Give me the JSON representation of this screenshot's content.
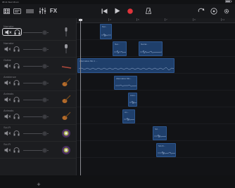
{
  "status": {
    "time": "08:41",
    "date": "Wed 18 oct.",
    "battery": ""
  },
  "toolbar": {
    "icons": [
      "my-songs-icon",
      "browser-icon",
      "tracks-view-icon",
      "mixer-icon",
      "fx-icon",
      "go-to-start-icon",
      "play-icon",
      "record-icon",
      "metronome-icon",
      "settings-icon",
      "help-icon",
      "loop-icon"
    ],
    "fx_label": "FX",
    "record_color": "#e0343b"
  },
  "ruler": {
    "numbers": [
      "1",
      "3",
      "5",
      "7",
      "9",
      "11"
    ]
  },
  "tracks": [
    {
      "name": "Narrator",
      "selected": true,
      "instrument": "microphone"
    },
    {
      "name": "Narrator",
      "selected": false,
      "instrument": "microphone"
    },
    {
      "name": "Guitar",
      "selected": false,
      "instrument": "guitar"
    },
    {
      "name": "Ambience",
      "selected": false,
      "instrument": "guitar"
    },
    {
      "name": "Animals",
      "selected": false,
      "instrument": "guitar"
    },
    {
      "name": "Animals",
      "selected": false,
      "instrument": "guitar"
    },
    {
      "name": "Sci-Fi",
      "selected": false,
      "instrument": "synth"
    },
    {
      "name": "Sci-Fi",
      "selected": false,
      "instrument": "synth"
    }
  ],
  "regions": [
    {
      "label": "Nar...",
      "track": 0
    },
    {
      "label": "Nar...",
      "track": 1
    },
    {
      "label": "Narrat...",
      "track": 1
    },
    {
      "label": "Alternative Mix 1 ...",
      "track": 2
    },
    {
      "label": "Alternative Mix...",
      "track": 3
    },
    {
      "label": "Anim...",
      "track": 4
    },
    {
      "label": "An...",
      "track": 5
    },
    {
      "label": "Sci...",
      "track": 6
    },
    {
      "label": "Sci-Fi...",
      "track": 7
    }
  ],
  "add_track_label": "+"
}
